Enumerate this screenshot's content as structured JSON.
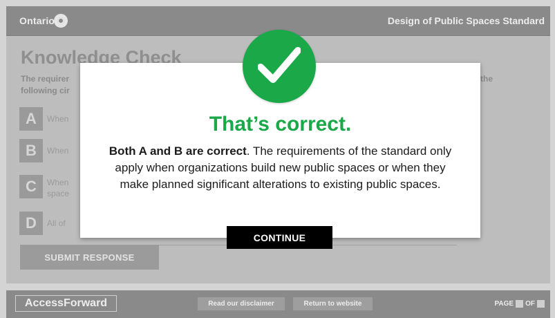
{
  "header": {
    "brand": "Ontario",
    "course_title": "Design of Public Spaces Standard"
  },
  "main": {
    "title": "Knowledge Check",
    "question_line1": "The requirer",
    "question_line1_end": "the",
    "question_line2": "following cir",
    "options": [
      {
        "letter": "A",
        "text": "When"
      },
      {
        "letter": "B",
        "text": "When"
      },
      {
        "letter": "C",
        "text_line1": "When",
        "text_line2": "space"
      },
      {
        "letter": "D",
        "text": "All of"
      }
    ],
    "submit_label": "SUBMIT RESPONSE"
  },
  "modal": {
    "title": "That’s correct.",
    "explanation_bold": "Both A and B are correct",
    "explanation_rest": ". The requirements of the standard only apply when organizations build new public spaces or when they make planned significant alterations to existing public spaces.",
    "continue_label": "CONTINUE"
  },
  "footer": {
    "logo": "AccessForward",
    "disclaimer_link": "Read our disclaimer",
    "website_link": "Return to website",
    "page_label": "PAGE",
    "of_label": "OF"
  },
  "colors": {
    "success_green": "#1aa849",
    "overlay_gray": "#8a8a8a"
  }
}
